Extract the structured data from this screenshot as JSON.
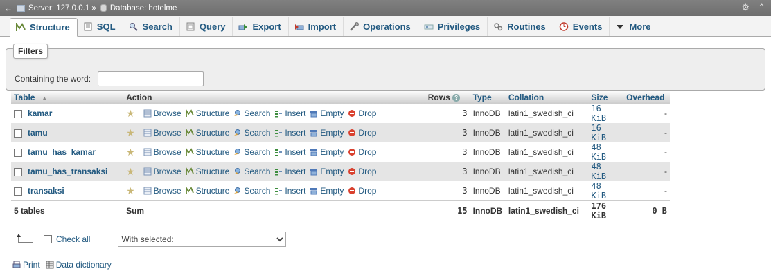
{
  "topbar": {
    "back": "←",
    "server": "Server: 127.0.0.1 »",
    "database": "Database: hotelme"
  },
  "tabs": [
    {
      "label": "Structure",
      "icon": "structure-icon",
      "active": true
    },
    {
      "label": "SQL",
      "icon": "sql-icon"
    },
    {
      "label": "Search",
      "icon": "search-icon"
    },
    {
      "label": "Query",
      "icon": "query-icon"
    },
    {
      "label": "Export",
      "icon": "export-icon"
    },
    {
      "label": "Import",
      "icon": "import-icon"
    },
    {
      "label": "Operations",
      "icon": "wrench-icon"
    },
    {
      "label": "Privileges",
      "icon": "privileges-icon"
    },
    {
      "label": "Routines",
      "icon": "routines-icon"
    },
    {
      "label": "Events",
      "icon": "clock-icon"
    },
    {
      "label": "More",
      "icon": "chevron-down-icon"
    }
  ],
  "filters": {
    "legend": "Filters",
    "label": "Containing the word:",
    "value": ""
  },
  "table": {
    "headers": {
      "table": "Table",
      "sort": "▲",
      "action": "Action",
      "rows": "Rows",
      "type": "Type",
      "collation": "Collation",
      "size": "Size",
      "overhead": "Overhead"
    },
    "actions": [
      "Browse",
      "Structure",
      "Search",
      "Insert",
      "Empty",
      "Drop"
    ],
    "rows": [
      {
        "name": "kamar",
        "rows": "3",
        "type": "InnoDB",
        "collation": "latin1_swedish_ci",
        "size": "16 KiB",
        "overhead": "-"
      },
      {
        "name": "tamu",
        "rows": "3",
        "type": "InnoDB",
        "collation": "latin1_swedish_ci",
        "size": "16 KiB",
        "overhead": "-"
      },
      {
        "name": "tamu_has_kamar",
        "rows": "3",
        "type": "InnoDB",
        "collation": "latin1_swedish_ci",
        "size": "48 KiB",
        "overhead": "-"
      },
      {
        "name": "tamu_has_transaksi",
        "rows": "3",
        "type": "InnoDB",
        "collation": "latin1_swedish_ci",
        "size": "48 KiB",
        "overhead": "-"
      },
      {
        "name": "transaksi",
        "rows": "3",
        "type": "InnoDB",
        "collation": "latin1_swedish_ci",
        "size": "48 KiB",
        "overhead": "-"
      }
    ],
    "footer": {
      "count": "5 tables",
      "label": "Sum",
      "rows": "15",
      "type": "InnoDB",
      "collation": "latin1_swedish_ci",
      "size": "176 KiB",
      "overhead": "0 B"
    }
  },
  "bottom": {
    "check_all": "Check all",
    "with_selected": "With selected:"
  },
  "links": {
    "print": "Print",
    "dictionary": "Data dictionary"
  },
  "colors": {
    "link": "#235a81",
    "topbar": "#7a7a7a",
    "row_alt": "#e5e5e5"
  }
}
